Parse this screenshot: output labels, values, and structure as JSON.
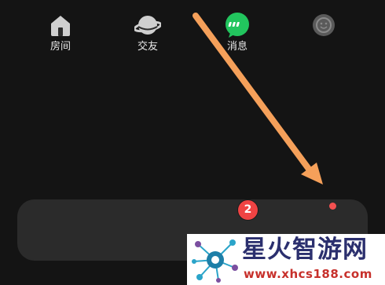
{
  "tabbar": {
    "tabs": [
      {
        "label": "房间",
        "icon": "home-icon"
      },
      {
        "label": "交友",
        "icon": "planet-icon"
      },
      {
        "label": "消息",
        "icon": "chat-bubble-icon"
      },
      {
        "label": "",
        "icon": "smile-face-icon"
      }
    ],
    "messages_badge": "2",
    "profile_has_red_dot": true
  },
  "colors": {
    "background": "#141414",
    "tabbar": "#2b2b2b",
    "accent_green": "#22c55e",
    "badge_red": "#f04343",
    "arrow_orange": "#f5a05a"
  },
  "watermark": {
    "title": "星火智游网",
    "url": "www.xhcs188.com"
  }
}
